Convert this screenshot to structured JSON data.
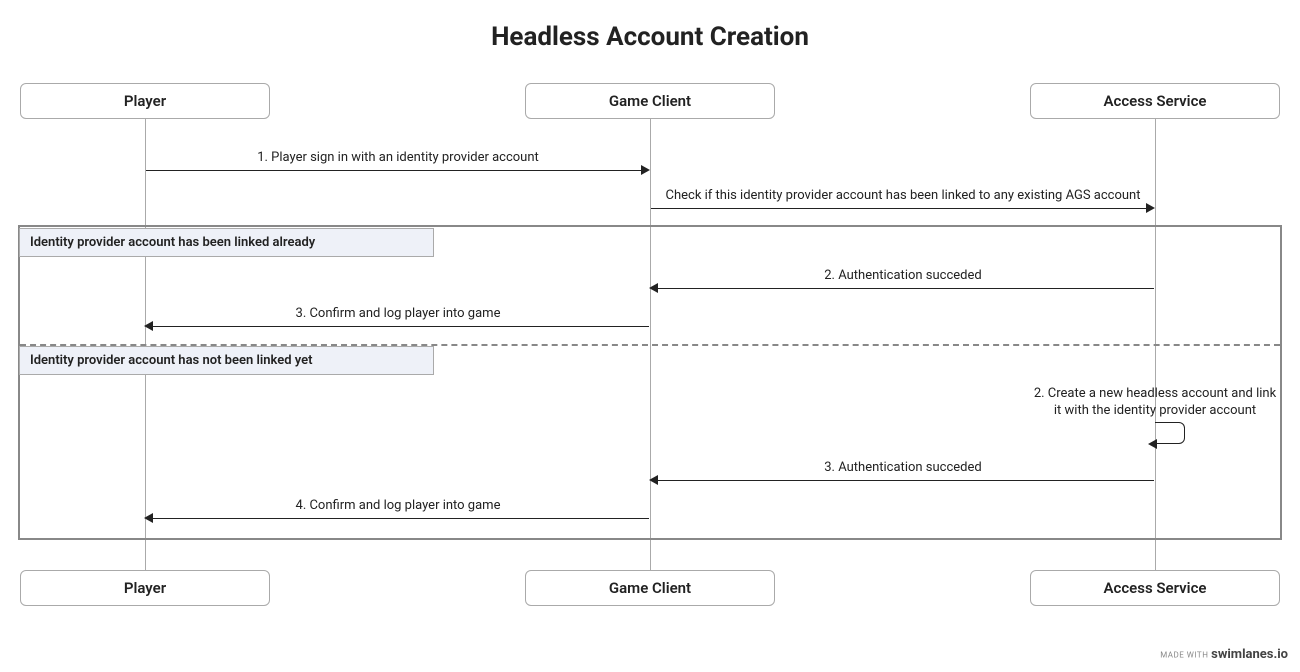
{
  "title": "Headless Account Creation",
  "lanes": {
    "player": "Player",
    "game_client": "Game Client",
    "access_service": "Access Service"
  },
  "messages": {
    "m1": "1. Player sign in with an identity provider account",
    "m_check": "Check if this identity provider account has been linked to any existing AGS account",
    "alt1_label": "Identity provider account has been linked already",
    "m2a": "2. Authentication succeded",
    "m3a": "3. Confirm and log player into game",
    "alt2_label": "Identity provider account has not been linked yet",
    "m2b_line1": "2. Create a new headless account and link",
    "m2b_line2": "it with the identity provider account",
    "m3b": "3. Authentication succeded",
    "m4b": "4. Confirm and log player into game"
  },
  "watermark": {
    "pre": "MADE WITH",
    "brand": "swimlanes.io"
  },
  "chart_data": {
    "type": "sequence_diagram",
    "title": "Headless Account Creation",
    "participants": [
      "Player",
      "Game Client",
      "Access Service"
    ],
    "steps": [
      {
        "from": "Player",
        "to": "Game Client",
        "label": "1. Player sign in with an identity provider account"
      },
      {
        "from": "Game Client",
        "to": "Access Service",
        "label": "Check if this identity provider account has been linked to any existing AGS account"
      }
    ],
    "alt": [
      {
        "condition": "Identity provider account has been linked already",
        "steps": [
          {
            "from": "Access Service",
            "to": "Game Client",
            "label": "2. Authentication succeded"
          },
          {
            "from": "Game Client",
            "to": "Player",
            "label": "3. Confirm and log player into game"
          }
        ]
      },
      {
        "condition": "Identity provider account has not been linked yet",
        "steps": [
          {
            "from": "Access Service",
            "to": "Access Service",
            "label": "2. Create a new headless account and link it with the identity provider account"
          },
          {
            "from": "Access Service",
            "to": "Game Client",
            "label": "3. Authentication succeded"
          },
          {
            "from": "Game Client",
            "to": "Player",
            "label": "4. Confirm and log player into game"
          }
        ]
      }
    ]
  }
}
